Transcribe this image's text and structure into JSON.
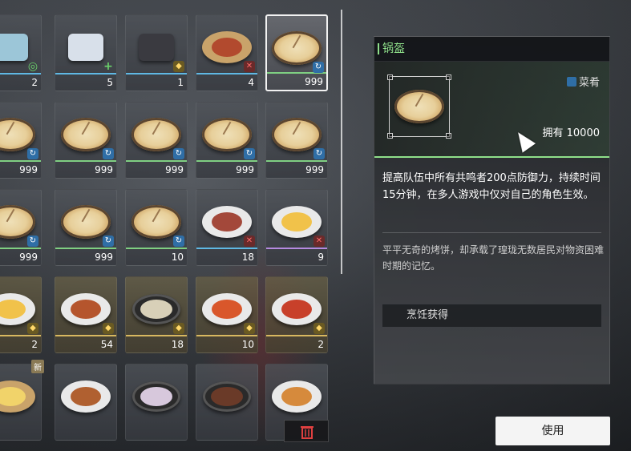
{
  "inventory": {
    "rows": [
      [
        {
          "count": "2",
          "food": "capsule",
          "badge": "green-ring",
          "bar": "blue"
        },
        {
          "count": "5",
          "food": "pack",
          "badge": "plus",
          "bar": "blue"
        },
        {
          "count": "1",
          "food": "crystal",
          "badge": "gold",
          "bar": "blue"
        },
        {
          "count": "4",
          "food": "skewers",
          "badge": "red",
          "bar": "blue"
        },
        {
          "count": "999",
          "food": "pie",
          "badge": "blue",
          "bar": "green",
          "selected": true
        }
      ],
      [
        {
          "count": "999",
          "food": "pie",
          "badge": "blue",
          "bar": "green"
        },
        {
          "count": "999",
          "food": "pie",
          "badge": "blue",
          "bar": "green"
        },
        {
          "count": "999",
          "food": "pie",
          "badge": "blue",
          "bar": "green"
        },
        {
          "count": "999",
          "food": "pie",
          "badge": "blue",
          "bar": "green"
        },
        {
          "count": "999",
          "food": "pie",
          "badge": "blue",
          "bar": "green"
        }
      ],
      [
        {
          "count": "999",
          "food": "pie",
          "badge": "blue",
          "bar": "green"
        },
        {
          "count": "999",
          "food": "pie",
          "badge": "blue",
          "bar": "green"
        },
        {
          "count": "10",
          "food": "pie",
          "badge": "blue",
          "bar": "green"
        },
        {
          "count": "18",
          "food": "meat",
          "badge": "red",
          "bar": "blue"
        },
        {
          "count": "9",
          "food": "omelette",
          "badge": "red",
          "bar": "purple"
        }
      ],
      [
        {
          "count": "2",
          "food": "omelette",
          "badge": "gold",
          "bar": "gold"
        },
        {
          "count": "54",
          "food": "fish",
          "badge": "gold",
          "bar": "gold"
        },
        {
          "count": "18",
          "food": "soup",
          "badge": "gold",
          "bar": "gold"
        },
        {
          "count": "10",
          "food": "shrimp",
          "badge": "gold",
          "bar": "gold"
        },
        {
          "count": "2",
          "food": "tofu",
          "badge": "gold",
          "bar": "gold"
        }
      ],
      [
        {
          "count": "",
          "food": "popcorn",
          "badge": "",
          "bar": "",
          "new_tag": "新"
        },
        {
          "count": "",
          "food": "cake",
          "badge": "",
          "bar": ""
        },
        {
          "count": "",
          "food": "dessert",
          "badge": "",
          "bar": ""
        },
        {
          "count": "",
          "food": "broth",
          "badge": "",
          "bar": ""
        },
        {
          "count": "",
          "food": "pizza",
          "badge": "",
          "bar": ""
        }
      ]
    ]
  },
  "detail": {
    "name": "锅盔",
    "category": "菜肴",
    "owned": "拥有 10000",
    "description": "提高队伍中所有共鸣者200点防御力，持续时间15分钟，在多人游戏中仅对自己的角色生效。",
    "flavor": "平平无奇的烤饼，却承载了瑝珑无数居民对物资困难时期的记忆。",
    "source": "烹饪获得"
  },
  "actions": {
    "use_label": "使用"
  },
  "colors": {
    "accent_green": "#8fe08a",
    "bar_blue": "#5fb8e4",
    "bar_green": "#7fcf82",
    "bar_gold": "#d8b860",
    "bar_purple": "#b58ae0"
  }
}
